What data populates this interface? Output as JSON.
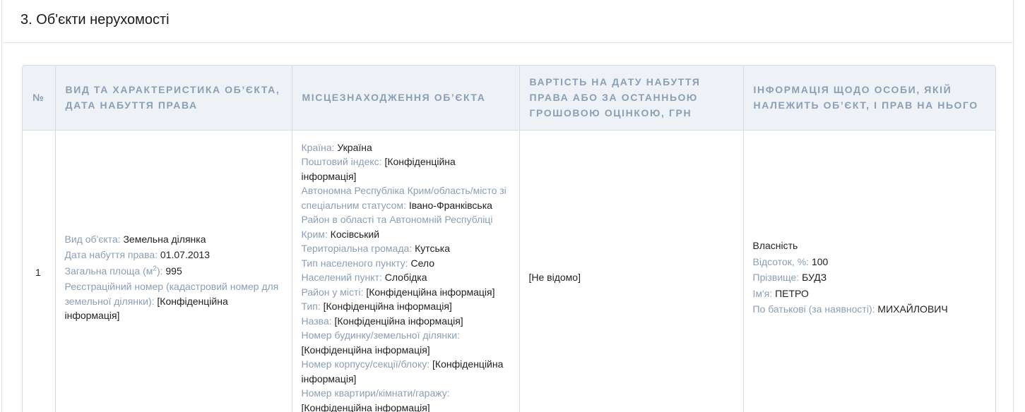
{
  "section": {
    "title": "3. Об'єкти нерухомості"
  },
  "table": {
    "headers": {
      "num": "№",
      "type": "Вид та характеристика об’єкта, дата набуття права",
      "location": "Місцезнаходження об’єкта",
      "cost": "Вартість на дату набуття права або за останньою грошовою оцінкою, грн",
      "owner": "Інформація щодо особи, якій належить об’єкт, і прав на нього"
    },
    "row": {
      "num": "1",
      "object": {
        "type_label": "Вид об'єкта:",
        "type_value": "Земельна ділянка",
        "date_label": "Дата набуття права:",
        "date_value": "01.07.2013",
        "area_label": "Загальна площа (м",
        "area_sup": "2",
        "area_label_end": "):",
        "area_value": "995",
        "cadastre_label": "Реєстраційний номер (кадастровий номер для земельної ділянки):",
        "cadastre_value": "[Конфіденційна інформація]"
      },
      "location": {
        "country_label": "Країна:",
        "country_value": "Україна",
        "postal_label": "Поштовий індекс:",
        "postal_value": "[Конфіденційна інформація]",
        "region_label": "Автономна Республіка Крим/область/місто зі спеціальним статусом:",
        "region_value": "Івано-Франківська",
        "district_label": "Район в області та Автономній Республіці Крим:",
        "district_value": "Косівський",
        "community_label": "Територіальна громада:",
        "community_value": "Кутська",
        "settlement_type_label": "Тип населеного пункту:",
        "settlement_type_value": "Село",
        "settlement_label": "Населений пункт:",
        "settlement_value": "Слобідка",
        "city_district_label": "Район у місті:",
        "city_district_value": "[Конфіденційна інформація]",
        "street_type_label": "Тип:",
        "street_type_value": "[Конфіденційна інформація]",
        "street_name_label": "Назва:",
        "street_name_value": "[Конфіденційна інформація]",
        "house_label": "Номер будинку/земельної ділянки:",
        "house_value": "[Конфіденційна інформація]",
        "building_label": "Номер корпусу/секції/блоку:",
        "building_value": "[Конфіденційна інформація]",
        "apartment_label": "Номер квартири/кімнати/гаражу:",
        "apartment_value": "[Конфіденційна інформація]"
      },
      "cost": "[Не відомо]",
      "owner": {
        "right_type": "Власність",
        "share_label": "Відсоток, %:",
        "share_value": "100",
        "surname_label": "Прізвище:",
        "surname_value": "БУДЗ",
        "name_label": "Ім'я:",
        "name_value": "ПЕТРО",
        "patronymic_label": "По батькові (за наявності):",
        "patronymic_value": "МИХАЙЛОВИЧ"
      }
    }
  },
  "colors": {
    "label": "#8a9fb5",
    "header_bg": "#eef2f6",
    "border": "#d3dde8"
  }
}
